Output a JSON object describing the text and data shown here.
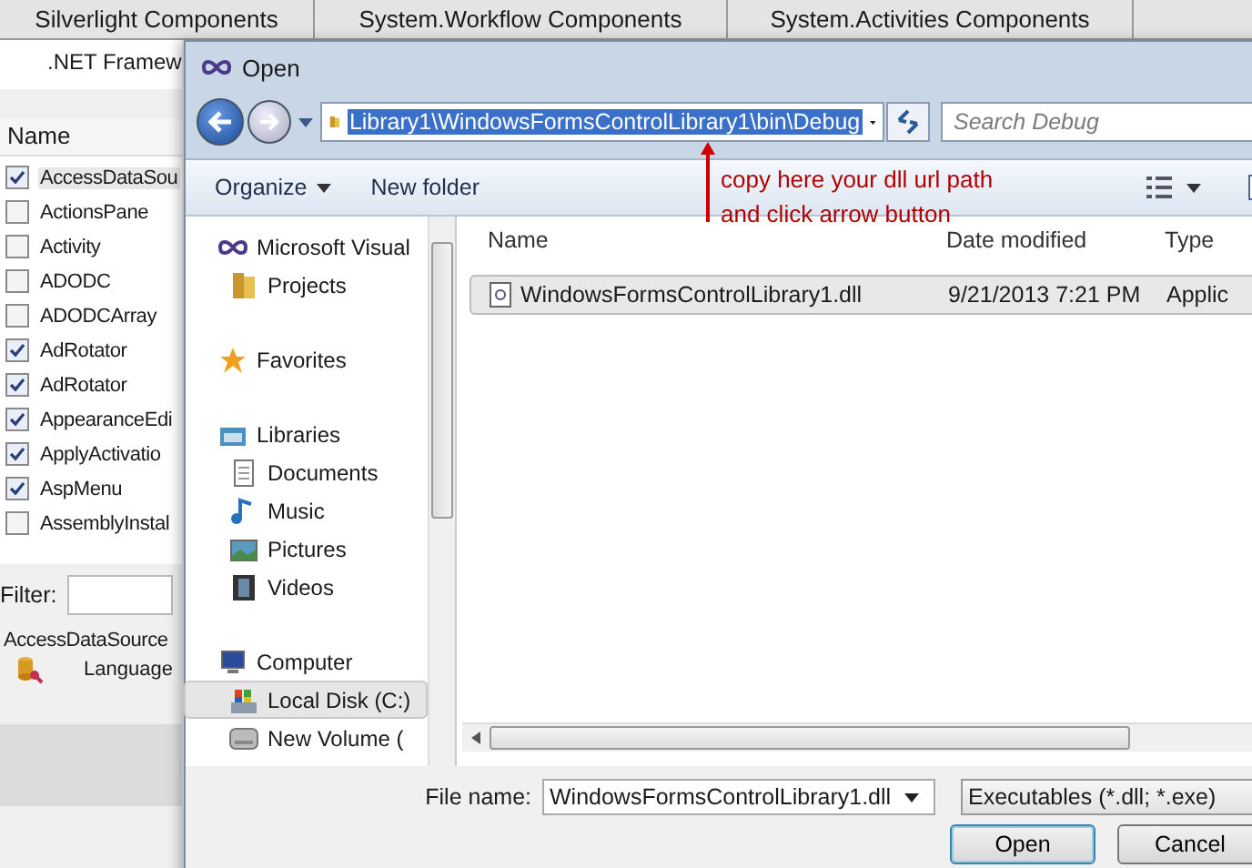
{
  "background_window": {
    "tabs": [
      {
        "label": "Silverlight Components"
      },
      {
        "label": "System.Workflow Components"
      },
      {
        "label": "System.Activities Components"
      }
    ],
    "subtab": ".NET Framew",
    "list_header": "Name",
    "items": [
      {
        "label": "AccessDataSou",
        "checked": true,
        "selected": true
      },
      {
        "label": "ActionsPane",
        "checked": false,
        "selected": false
      },
      {
        "label": "Activity",
        "checked": false,
        "selected": false
      },
      {
        "label": "ADODC",
        "checked": false,
        "selected": false
      },
      {
        "label": "ADODCArray",
        "checked": false,
        "selected": false
      },
      {
        "label": "AdRotator",
        "checked": true,
        "selected": false
      },
      {
        "label": "AdRotator",
        "checked": true,
        "selected": false
      },
      {
        "label": "AppearanceEdi",
        "checked": true,
        "selected": false
      },
      {
        "label": "ApplyActivatio",
        "checked": true,
        "selected": false
      },
      {
        "label": "AspMenu",
        "checked": true,
        "selected": false
      },
      {
        "label": "AssemblyInstal",
        "checked": false,
        "selected": false
      }
    ],
    "filter_label": "Filter:",
    "tree_root": "AccessDataSource",
    "tree_child": "Language"
  },
  "dialog": {
    "title": "Open",
    "address": "Library1\\WindowsFormsControlLibrary1\\bin\\Debug",
    "search": {
      "placeholder": "Search Debug"
    },
    "toolbar": [
      {
        "label": "Organize",
        "kind": "menu"
      },
      {
        "label": "New folder",
        "kind": "plain"
      }
    ],
    "nav": [
      {
        "label": "Microsoft Visual",
        "kind": "group",
        "selected": false
      },
      {
        "label": "Projects",
        "kind": "item",
        "selected": false
      },
      {
        "label": "Favorites",
        "kind": "group",
        "selected": false
      },
      {
        "label": "Libraries",
        "kind": "group",
        "selected": false
      },
      {
        "label": "Documents",
        "kind": "item",
        "selected": false
      },
      {
        "label": "Music",
        "kind": "item",
        "selected": false
      },
      {
        "label": "Pictures",
        "kind": "item",
        "selected": false
      },
      {
        "label": "Videos",
        "kind": "item",
        "selected": false
      },
      {
        "label": "Computer",
        "kind": "group",
        "selected": false
      },
      {
        "label": "Local Disk (C:)",
        "kind": "item",
        "selected": true
      },
      {
        "label": "New Volume (",
        "kind": "item",
        "selected": false
      }
    ],
    "columns": [
      "Name",
      "Date modified",
      "Type"
    ],
    "files": [
      {
        "name": "WindowsFormsControlLibrary1.dll",
        "date": "9/21/2013 7:21 PM",
        "type": "Applic",
        "selected": true
      }
    ],
    "file_name_label": "File name:",
    "file_name": "WindowsFormsControlLibrary1.dll",
    "file_type": "Executables (*.dll; *.exe)",
    "buttons": [
      "Open",
      "Cancel"
    ]
  },
  "annotation": {
    "lines": [
      "copy here your dll url path",
      "and click arrow button"
    ]
  }
}
